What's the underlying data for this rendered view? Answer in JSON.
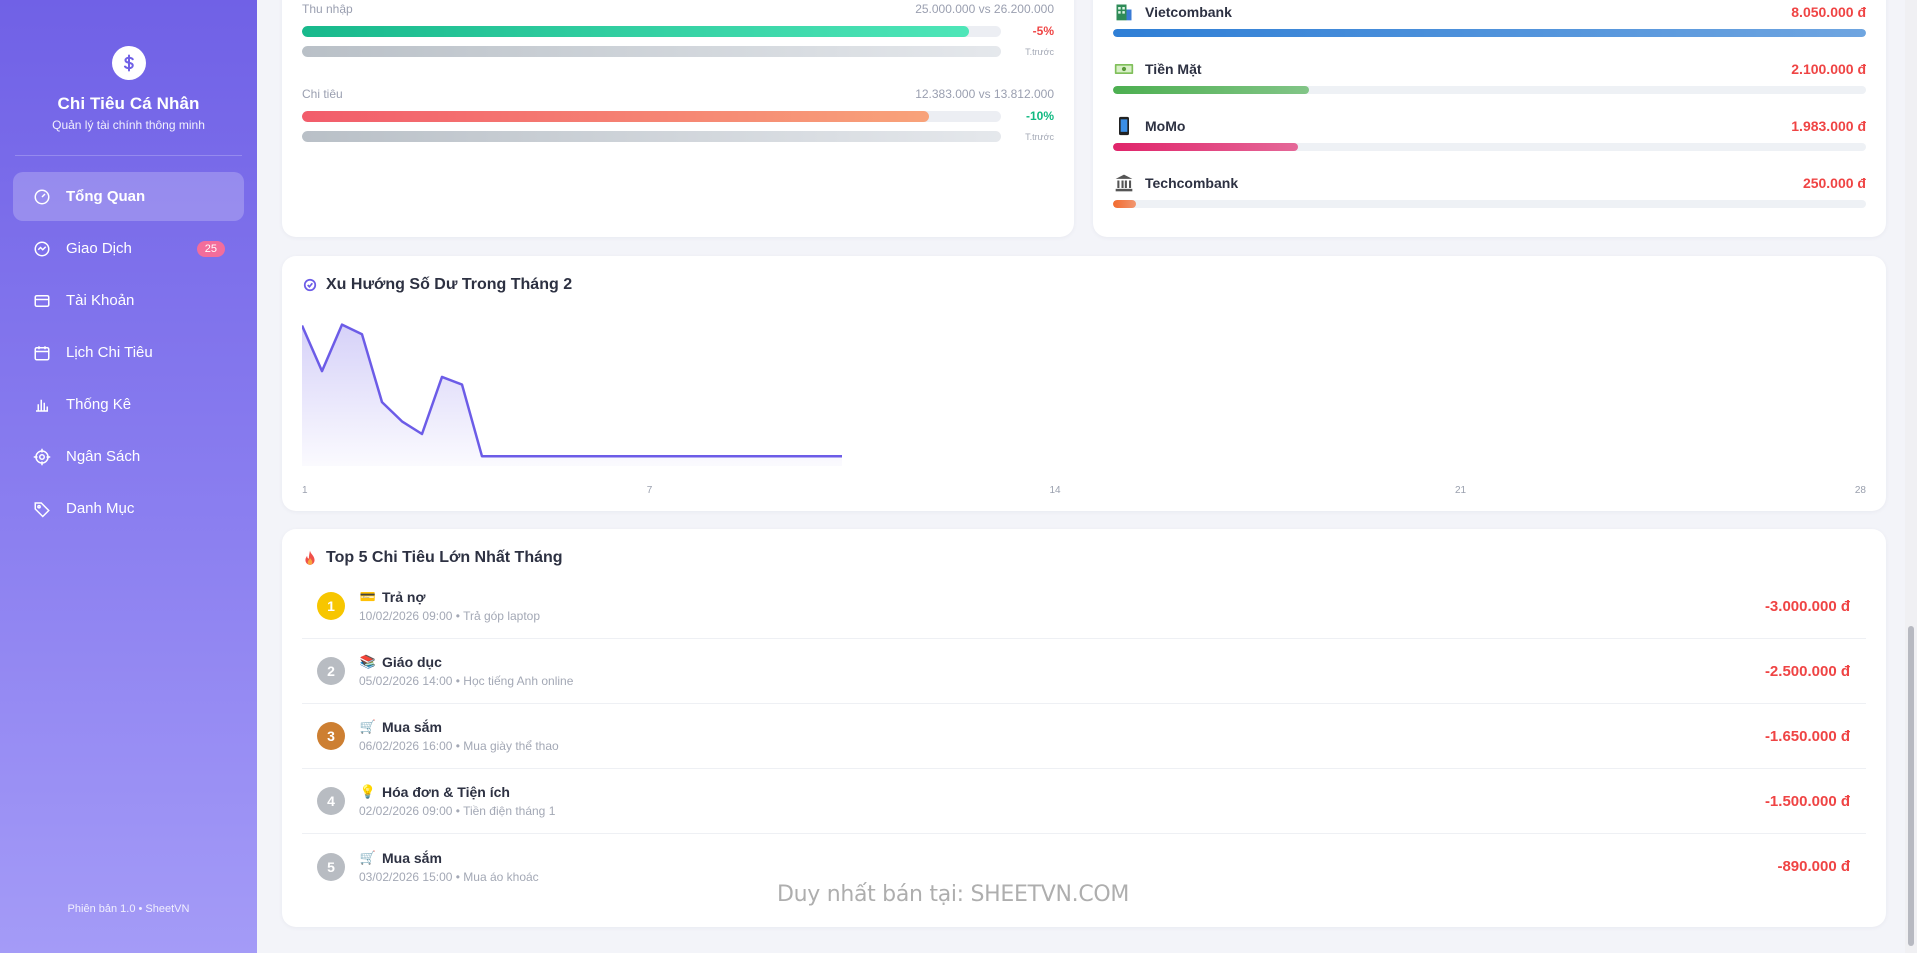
{
  "sidebar": {
    "title": "Chi Tiêu Cá Nhân",
    "subtitle": "Quản lý tài chính thông minh",
    "logo_icon": "dollar-icon",
    "items": [
      {
        "label": "Tổng Quan",
        "icon": "dashboard-icon",
        "active": true
      },
      {
        "label": "Giao Dịch",
        "icon": "transactions-icon",
        "badge": "25"
      },
      {
        "label": "Tài Khoản",
        "icon": "wallet-icon"
      },
      {
        "label": "Lịch Chi Tiêu",
        "icon": "calendar-icon"
      },
      {
        "label": "Thống Kê",
        "icon": "chart-bar-icon"
      },
      {
        "label": "Ngân Sách",
        "icon": "target-icon"
      },
      {
        "label": "Danh Mục",
        "icon": "tag-icon"
      }
    ],
    "footer": "Phiên bản 1.0 • SheetVN"
  },
  "comparison": {
    "income": {
      "label": "Thu nhập",
      "values": "25.000.000 vs 26.200.000",
      "change": "-5%",
      "current_pct": 95.4,
      "prev_label": "T.trước",
      "prev_pct": 100
    },
    "expense": {
      "label": "Chi tiêu",
      "values": "12.383.000 vs 13.812.000",
      "change": "-10%",
      "current_pct": 89.7,
      "prev_label": "T.trước",
      "prev_pct": 100
    }
  },
  "accounts": [
    {
      "name": "Vietcombank",
      "amount": "8.050.000 đ",
      "icon": "building-icon",
      "pct": 100,
      "color": "#2f7fd6"
    },
    {
      "name": "Tiền Mặt",
      "amount": "2.100.000 đ",
      "icon": "cash-icon",
      "pct": 26,
      "color": "#4caf50"
    },
    {
      "name": "MoMo",
      "amount": "1.983.000 đ",
      "icon": "phone-icon",
      "pct": 24.6,
      "color": "#e0246a"
    },
    {
      "name": "Techcombank",
      "amount": "250.000 đ",
      "icon": "bank-icon",
      "pct": 3.1,
      "color": "#f26a2e"
    }
  ],
  "trend": {
    "title": "Xu Hướng Số Dư Trong Tháng 2",
    "title_icon": "check-circle-icon"
  },
  "chart_data": {
    "type": "area",
    "title": "Xu Hướng Số Dư Trong Tháng 2",
    "x": [
      1,
      2,
      3,
      4,
      5,
      6,
      7,
      8,
      9,
      10,
      11,
      12,
      13,
      14,
      15,
      16,
      17,
      18,
      19,
      20,
      21,
      22,
      23,
      24,
      25,
      26,
      27,
      28
    ],
    "x_ticks": [
      "1",
      "7",
      "14",
      "21",
      "28"
    ],
    "series": [
      {
        "values": [
          14.5,
          9.8,
          14.6,
          13.6,
          6.6,
          4.6,
          3.3,
          9.2,
          8.4,
          1,
          1,
          1,
          1,
          1,
          1,
          1,
          1,
          1,
          1,
          1,
          1,
          1,
          1,
          1,
          1,
          1,
          1,
          1
        ],
        "color": "#6c5ce7"
      }
    ],
    "xlim": [
      1,
      28
    ],
    "ylim": [
      0,
      16
    ],
    "grid": false
  },
  "top": {
    "title": "Top 5 Chi Tiêu Lớn Nhất Tháng",
    "title_icon": "fire-icon",
    "items": [
      {
        "rank": "1",
        "rank_color": "#f7c600",
        "icon": "card-icon",
        "glyph": "💳",
        "category": "Trả nợ",
        "meta": "10/02/2026 09:00 • Trả góp laptop",
        "amount": "-3.000.000 đ"
      },
      {
        "rank": "2",
        "rank_color": "#b8bcc2",
        "icon": "books-icon",
        "glyph": "📚",
        "category": "Giáo dục",
        "meta": "05/02/2026 14:00 • Học tiếng Anh online",
        "amount": "-2.500.000 đ"
      },
      {
        "rank": "3",
        "rank_color": "#cd7f32",
        "icon": "cart-icon",
        "glyph": "🛒",
        "category": "Mua sắm",
        "meta": "06/02/2026 16:00 • Mua giày thể thao",
        "amount": "-1.650.000 đ"
      },
      {
        "rank": "4",
        "rank_color": "#b8bcc2",
        "icon": "bulb-icon",
        "glyph": "💡",
        "category": "Hóa đơn & Tiện ích",
        "meta": "02/02/2026 09:00 • Tiền điện tháng 1",
        "amount": "-1.500.000 đ"
      },
      {
        "rank": "5",
        "rank_color": "#b8bcc2",
        "icon": "cart-icon",
        "glyph": "🛒",
        "category": "Mua sắm",
        "meta": "03/02/2026 15:00 • Mua áo khoác",
        "amount": "-890.000 đ"
      }
    ]
  },
  "watermark": "Duy nhất bán tại: SHEETVN.COM"
}
